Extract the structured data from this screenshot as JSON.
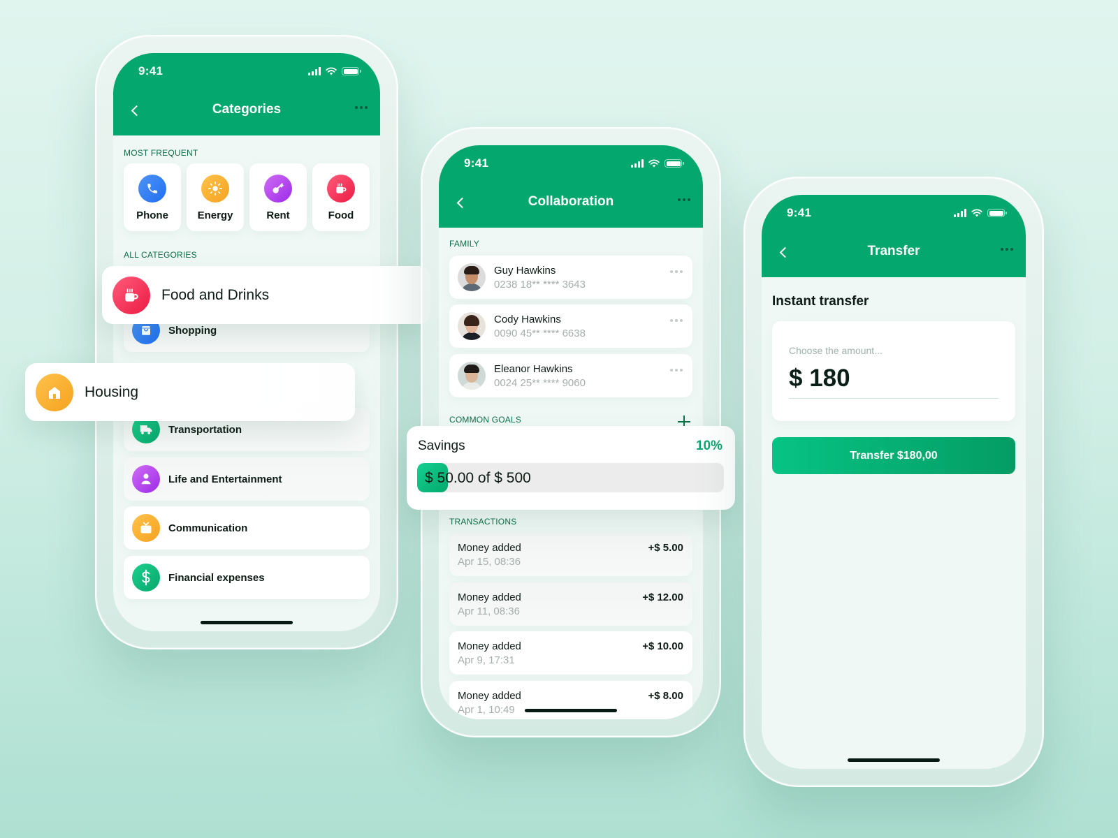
{
  "status_bar": {
    "time": "9:41"
  },
  "categories_screen": {
    "title": "Categories",
    "most_frequent_label": "MOST FREQUENT",
    "most_frequent": [
      {
        "label": "Phone",
        "icon": "phone-icon",
        "color": "#2f7ff4"
      },
      {
        "label": "Energy",
        "icon": "sun-icon",
        "color": "#f7ad2c"
      },
      {
        "label": "Rent",
        "icon": "key-icon",
        "color": "#b23df0"
      },
      {
        "label": "Food",
        "icon": "coffee-cup-icon",
        "color": "#f2355a"
      }
    ],
    "all_categories_label": "ALL CATEGORIES",
    "categories": [
      {
        "label": "Food and Drinks",
        "icon": "coffee-cup-icon",
        "color": "#f2355a",
        "highlighted": true
      },
      {
        "label": "Shopping",
        "icon": "shopping-bag-icon",
        "color": "#2f7ff4"
      },
      {
        "label": "Housing",
        "icon": "house-icon",
        "color": "#f7ad2c",
        "highlighted": true
      },
      {
        "label": "Transportation",
        "icon": "truck-icon",
        "color": "#10b97c"
      },
      {
        "label": "Life and Entertainment",
        "icon": "person-icon",
        "color": "#b23df0"
      },
      {
        "label": "Communication",
        "icon": "tv-icon",
        "color": "#f7ad2c"
      },
      {
        "label": "Financial expenses",
        "icon": "dollar-icon",
        "color": "#10b97c"
      }
    ]
  },
  "collaboration_screen": {
    "title": "Collaboration",
    "family_label": "FAMILY",
    "family": [
      {
        "name": "Guy Hawkins",
        "account": "0238 18** **** 3643"
      },
      {
        "name": "Cody Hawkins",
        "account": "0090 45** **** 6638"
      },
      {
        "name": "Eleanor Hawkins",
        "account": "0024 25** **** 9060"
      }
    ],
    "common_goals_label": "COMMON GOALS",
    "goal": {
      "name": "Savings",
      "percent_label": "10%",
      "progress": 0.1,
      "amount_text": "$ 50.00 of $ 500"
    },
    "transactions_label": "TRANSACTIONS",
    "transactions": [
      {
        "title": "Money added",
        "date": "Apr 15, 08:36",
        "amount": "+$ 5.00"
      },
      {
        "title": "Money added",
        "date": "Apr 11, 08:36",
        "amount": "+$ 12.00"
      },
      {
        "title": "Money added",
        "date": "Apr 9, 17:31",
        "amount": "+$ 10.00"
      },
      {
        "title": "Money added",
        "date": "Apr 1, 10:49",
        "amount": "+$ 8.00"
      }
    ]
  },
  "transfer_screen": {
    "title": "Transfer",
    "heading": "Instant transfer",
    "amount_placeholder": "Choose the amount...",
    "amount_value": "$ 180",
    "button_label": "Transfer $180,00"
  },
  "colors": {
    "brand_green": "#04a86e",
    "section_label": "#0b6e48",
    "goal_accent": "#0aa870"
  }
}
